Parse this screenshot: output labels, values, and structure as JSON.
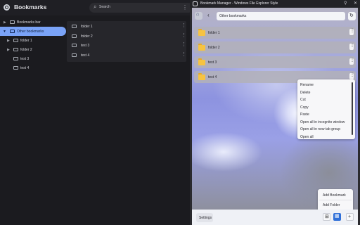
{
  "left": {
    "app_title": "Bookmarks",
    "search_placeholder": "Search",
    "search_icon": "search-icon",
    "menu_glyph": "⋮",
    "tree": [
      {
        "label": "Bookmarks bar",
        "expanded": false,
        "selected": false
      },
      {
        "label": "Other bookmarks",
        "expanded": true,
        "selected": true
      },
      {
        "label": "folder 1",
        "expanded": false,
        "selected": false
      },
      {
        "label": "folder 2",
        "expanded": false,
        "selected": false
      },
      {
        "label": "test 3",
        "selected": false
      },
      {
        "label": "test 4",
        "selected": false
      }
    ],
    "list": [
      {
        "label": "folder 1"
      },
      {
        "label": "folder 2"
      },
      {
        "label": "test 3"
      },
      {
        "label": "test 4"
      }
    ],
    "colors": {
      "accent": "#7aa3f7",
      "background": "#1b1b1f"
    }
  },
  "right": {
    "title": "Bookmark Manager - Windows File Explorer Style",
    "path": "Other bookmarks",
    "items": [
      {
        "label": "folder 1"
      },
      {
        "label": "folder 2"
      },
      {
        "label": "test 3"
      },
      {
        "label": "test 4"
      }
    ],
    "context_menu": [
      "Rename",
      "Delete",
      "Cut",
      "Copy",
      "Paste",
      "Open all in incognito window",
      "Open all in new tab group",
      "Open all"
    ],
    "add_menu": {
      "bookmark": "Add Bookmark",
      "folder": "Add Folder"
    },
    "settings_label": "Settings",
    "view_buttons": [
      {
        "name": "grid-view",
        "glyph": "⊞",
        "active": false
      },
      {
        "name": "list-view",
        "glyph": "▦",
        "active": true
      },
      {
        "name": "add",
        "glyph": "+",
        "active": false
      }
    ],
    "colors": {
      "folder": "#f6c342",
      "active_button": "#2f6fd8"
    }
  }
}
